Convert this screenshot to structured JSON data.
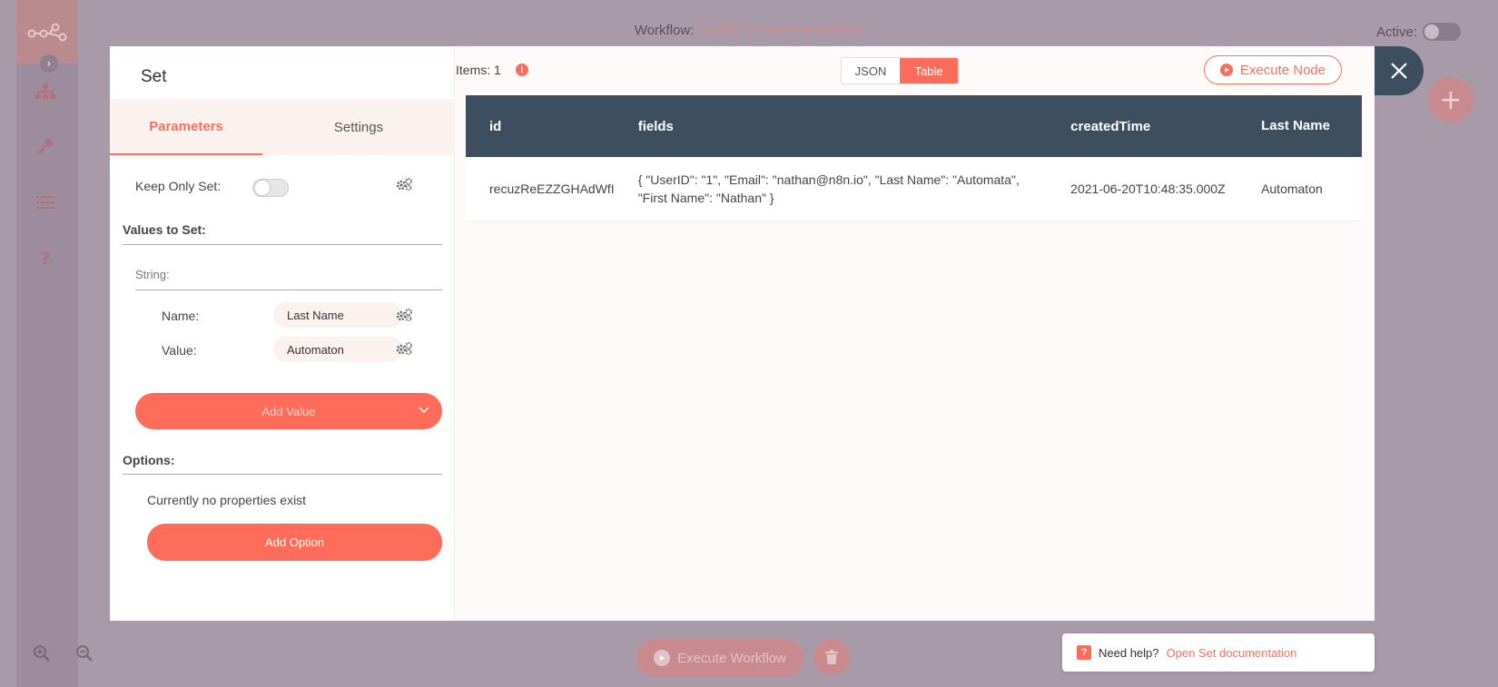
{
  "app": {
    "workflow_prefix": "Workflow:",
    "workflow_name": "Update a record on Airtable",
    "active_label": "Active:",
    "execute_workflow_label": "Execute Workflow"
  },
  "help": {
    "question_mark": "?",
    "text": "Need help?",
    "link": "Open Set documentation"
  },
  "node_panel": {
    "title": "Set",
    "tabs": [
      "Parameters",
      "Settings"
    ],
    "keep_only_set_label": "Keep Only Set:",
    "keep_only_set_value": false,
    "values_to_set_label": "Values to Set:",
    "string_label": "String:",
    "name_label": "Name:",
    "name_value": "Last Name",
    "value_label": "Value:",
    "value_value": "Automaton",
    "add_value_label": "Add Value",
    "options_label": "Options:",
    "no_properties_text": "Currently no properties exist",
    "add_option_label": "Add Option"
  },
  "output": {
    "items_label": "Items: 1",
    "info_icon": "i",
    "view_tabs": [
      "JSON",
      "Table"
    ],
    "selected_view": "Table",
    "execute_node_label": "Execute Node",
    "table": {
      "headers": [
        "id",
        "fields",
        "createdTime",
        "Last Name"
      ],
      "rows": [
        {
          "id": "recuzReEZZGHAdWfI",
          "fields": "{ \"UserID\": \"1\", \"Email\": \"nathan@n8n.io\", \"Last Name\": \"Automata\", \"First Name\": \"Nathan\" }",
          "createdTime": "2021-06-20T10:48:35.000Z",
          "last_name": "Automaton"
        }
      ]
    }
  },
  "colors": {
    "accent": "#ff6d5a",
    "table_header": "#3d4f5e",
    "overlay_bg": "#a99aa9"
  }
}
